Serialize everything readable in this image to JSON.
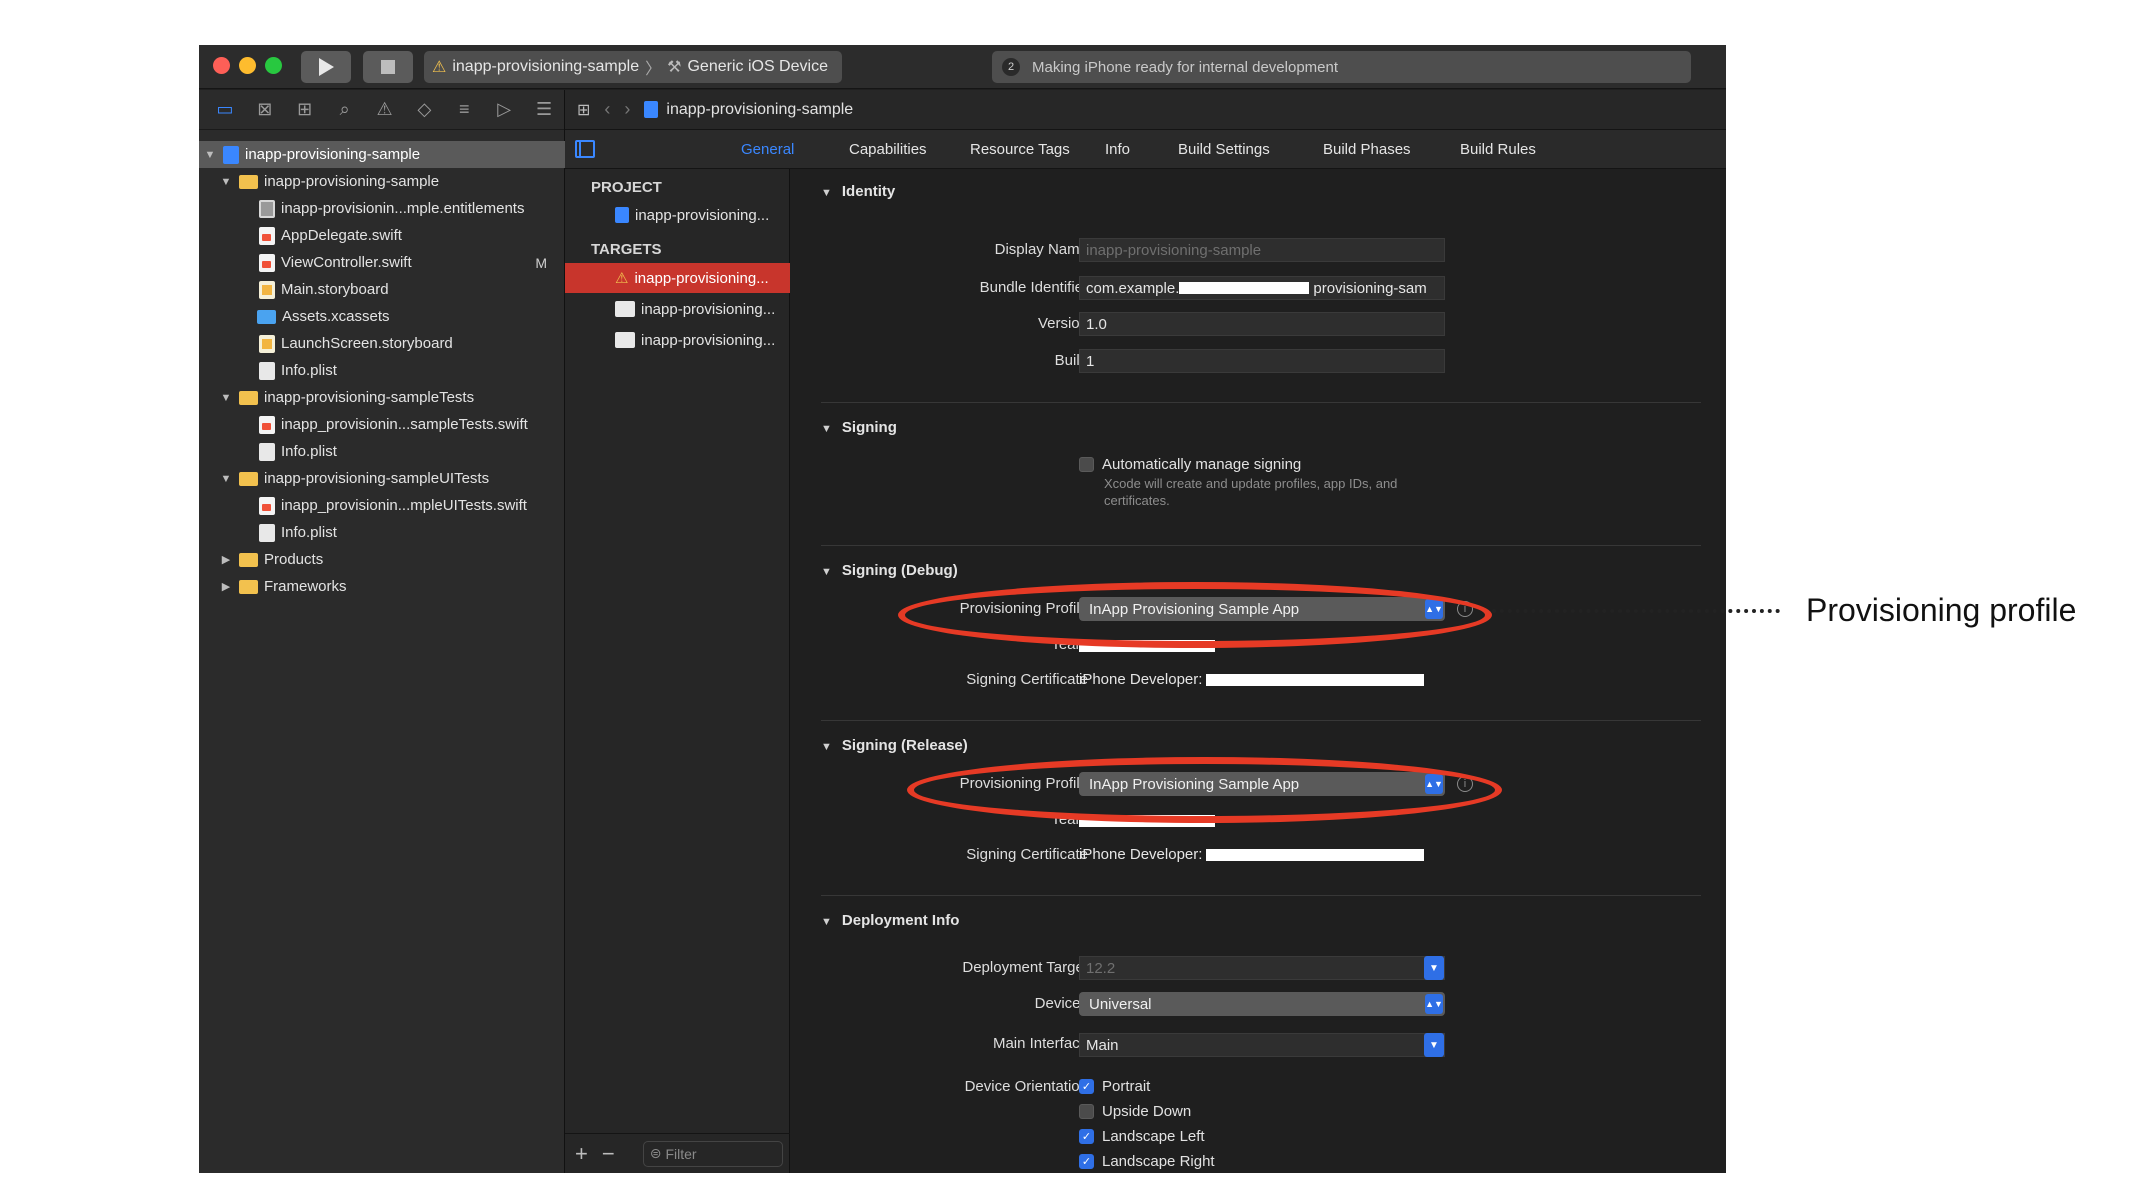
{
  "toolbar": {
    "scheme_project": "inapp-provisioning-sample",
    "scheme_separator": "〉",
    "scheme_device": "Generic iOS Device",
    "status_count": "2",
    "status_text": "Making iPhone ready for internal development"
  },
  "navigator": {
    "items": [
      {
        "label": "inapp-provisioning-sample"
      },
      {
        "label": "inapp-provisioning-sample"
      },
      {
        "label": "inapp-provisionin...mple.entitlements"
      },
      {
        "label": "AppDelegate.swift"
      },
      {
        "label": "ViewController.swift",
        "flag": "M"
      },
      {
        "label": "Main.storyboard"
      },
      {
        "label": "Assets.xcassets"
      },
      {
        "label": "LaunchScreen.storyboard"
      },
      {
        "label": "Info.plist"
      },
      {
        "label": "inapp-provisioning-sampleTests"
      },
      {
        "label": "inapp_provisionin...sampleTests.swift"
      },
      {
        "label": "Info.plist"
      },
      {
        "label": "inapp-provisioning-sampleUITests"
      },
      {
        "label": "inapp_provisionin...mpleUITests.swift"
      },
      {
        "label": "Info.plist"
      },
      {
        "label": "Products"
      },
      {
        "label": "Frameworks"
      }
    ]
  },
  "jumpbar": {
    "label": "inapp-provisioning-sample"
  },
  "tabs": [
    "General",
    "Capabilities",
    "Resource Tags",
    "Info",
    "Build Settings",
    "Build Phases",
    "Build Rules"
  ],
  "targets": {
    "project_header": "PROJECT",
    "project_item": "inapp-provisioning...",
    "targets_header": "TARGETS",
    "items": [
      "inapp-provisioning...",
      "inapp-provisioning...",
      "inapp-provisioning..."
    ],
    "filter_placeholder": "Filter"
  },
  "identity": {
    "title": "Identity",
    "display_name_label": "Display Name",
    "display_name_placeholder": "inapp-provisioning-sample",
    "bundle_label": "Bundle Identifier",
    "bundle_prefix": "com.example.",
    "bundle_suffix": "provisioning-sam",
    "version_label": "Version",
    "version_value": "1.0",
    "build_label": "Build",
    "build_value": "1"
  },
  "signing": {
    "title": "Signing",
    "auto_label": "Automatically manage signing",
    "auto_hint": "Xcode will create and update profiles, app IDs, and certificates."
  },
  "signing_debug": {
    "title": "Signing (Debug)",
    "profile_label": "Provisioning Profile",
    "profile_value": "InApp Provisioning Sample App",
    "team_label": "Team",
    "cert_label": "Signing Certificate",
    "cert_value": "iPhone Developer: "
  },
  "signing_release": {
    "title": "Signing (Release)",
    "profile_label": "Provisioning Profile",
    "profile_value": "InApp Provisioning Sample App",
    "team_label": "Team",
    "cert_label": "Signing Certificate",
    "cert_value": "iPhone Developer: "
  },
  "deployment": {
    "title": "Deployment Info",
    "target_label": "Deployment Target",
    "target_placeholder": "12.2",
    "devices_label": "Devices",
    "devices_value": "Universal",
    "interface_label": "Main Interface",
    "interface_value": "Main",
    "orientation_label": "Device Orientation",
    "orientations": [
      "Portrait",
      "Upside Down",
      "Landscape Left",
      "Landscape Right"
    ]
  },
  "annotation": {
    "callout": "Provisioning profile"
  },
  "colors": {
    "accent": "#3a87ff",
    "selection": "#c8352c",
    "annotation": "#e63a25"
  }
}
